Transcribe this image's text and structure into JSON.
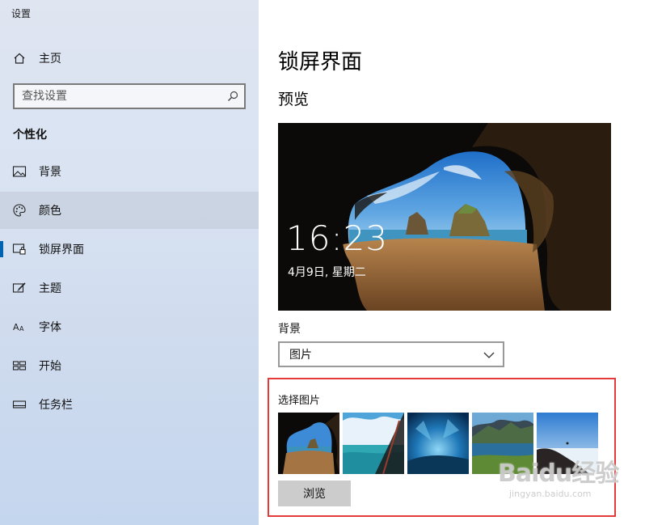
{
  "window": {
    "title": "设置"
  },
  "sidebar": {
    "home": "主页",
    "search_placeholder": "查找设置",
    "section": "个性化",
    "items": [
      {
        "label": "背景",
        "icon": "picture-icon"
      },
      {
        "label": "颜色",
        "icon": "palette-icon"
      },
      {
        "label": "锁屏界面",
        "icon": "lock-screen-icon"
      },
      {
        "label": "主题",
        "icon": "theme-brush-icon"
      },
      {
        "label": "字体",
        "icon": "font-icon"
      },
      {
        "label": "开始",
        "icon": "start-grid-icon"
      },
      {
        "label": "任务栏",
        "icon": "taskbar-icon"
      }
    ]
  },
  "main": {
    "title": "锁屏界面",
    "preview_heading": "预览",
    "preview": {
      "time": "16:23",
      "date": "4月9日, 星期二"
    },
    "background_label": "背景",
    "background_value": "图片",
    "choose_label": "选择图片",
    "browse_label": "浏览"
  },
  "watermark": {
    "main": "Baidu经验",
    "sub": "jingyan.baidu.com"
  },
  "colors": {
    "accent": "#0063b1",
    "highlight": "#e53a3a"
  }
}
